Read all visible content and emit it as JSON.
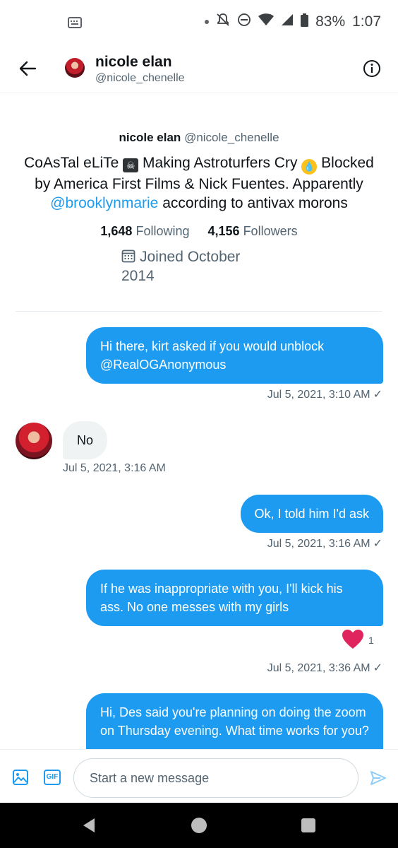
{
  "status_bar": {
    "battery": "83%",
    "time": "1:07"
  },
  "header": {
    "name": "nicole elan",
    "handle": "@nicole_chenelle"
  },
  "profile": {
    "name": "nicole elan",
    "handle": "@nicole_chenelle",
    "bio_part1": "CoAsTal eLiTe",
    "bio_part2": "Making Astroturfers Cry",
    "bio_part3": "Blocked by America First Films & Nick Fuentes. Apparently",
    "bio_mention": "@brooklynmarie",
    "bio_part4": "according to antivax morons",
    "following_count": "1,648",
    "following_label": "Following",
    "followers_count": "4,156",
    "followers_label": "Followers",
    "joined": "Joined October 2014"
  },
  "messages": [
    {
      "direction": "out",
      "text": "Hi there, kirt asked if you would unblock @RealOGAnonymous",
      "timestamp": "Jul 5, 2021, 3:10 AM"
    },
    {
      "direction": "in",
      "text": "No",
      "timestamp": "Jul 5, 2021, 3:16 AM"
    },
    {
      "direction": "out",
      "text": "Ok, I told him I'd ask",
      "timestamp": "Jul 5, 2021, 3:16 AM"
    },
    {
      "direction": "out",
      "text": "If he was inappropriate with you, I'll kick his ass. No one messes with my girls",
      "timestamp": "Jul 5, 2021, 3:36 AM",
      "reaction_count": "1"
    },
    {
      "direction": "out",
      "text": "Hi, Des said you're planning on doing the zoom on Thursday evening. What time works for you?"
    }
  ],
  "composer": {
    "placeholder": "Start a new message",
    "gif_label": "GIF"
  },
  "colors": {
    "accent": "#1d9bf0",
    "text": "#0f1419",
    "muted": "#536471",
    "bubble_in": "#eff3f4",
    "heart": "#e0245e"
  },
  "icons": [
    "back-arrow-icon",
    "info-icon",
    "calendar-icon",
    "image-icon",
    "gif-icon",
    "send-icon",
    "heart-icon",
    "checkmark-icon"
  ]
}
